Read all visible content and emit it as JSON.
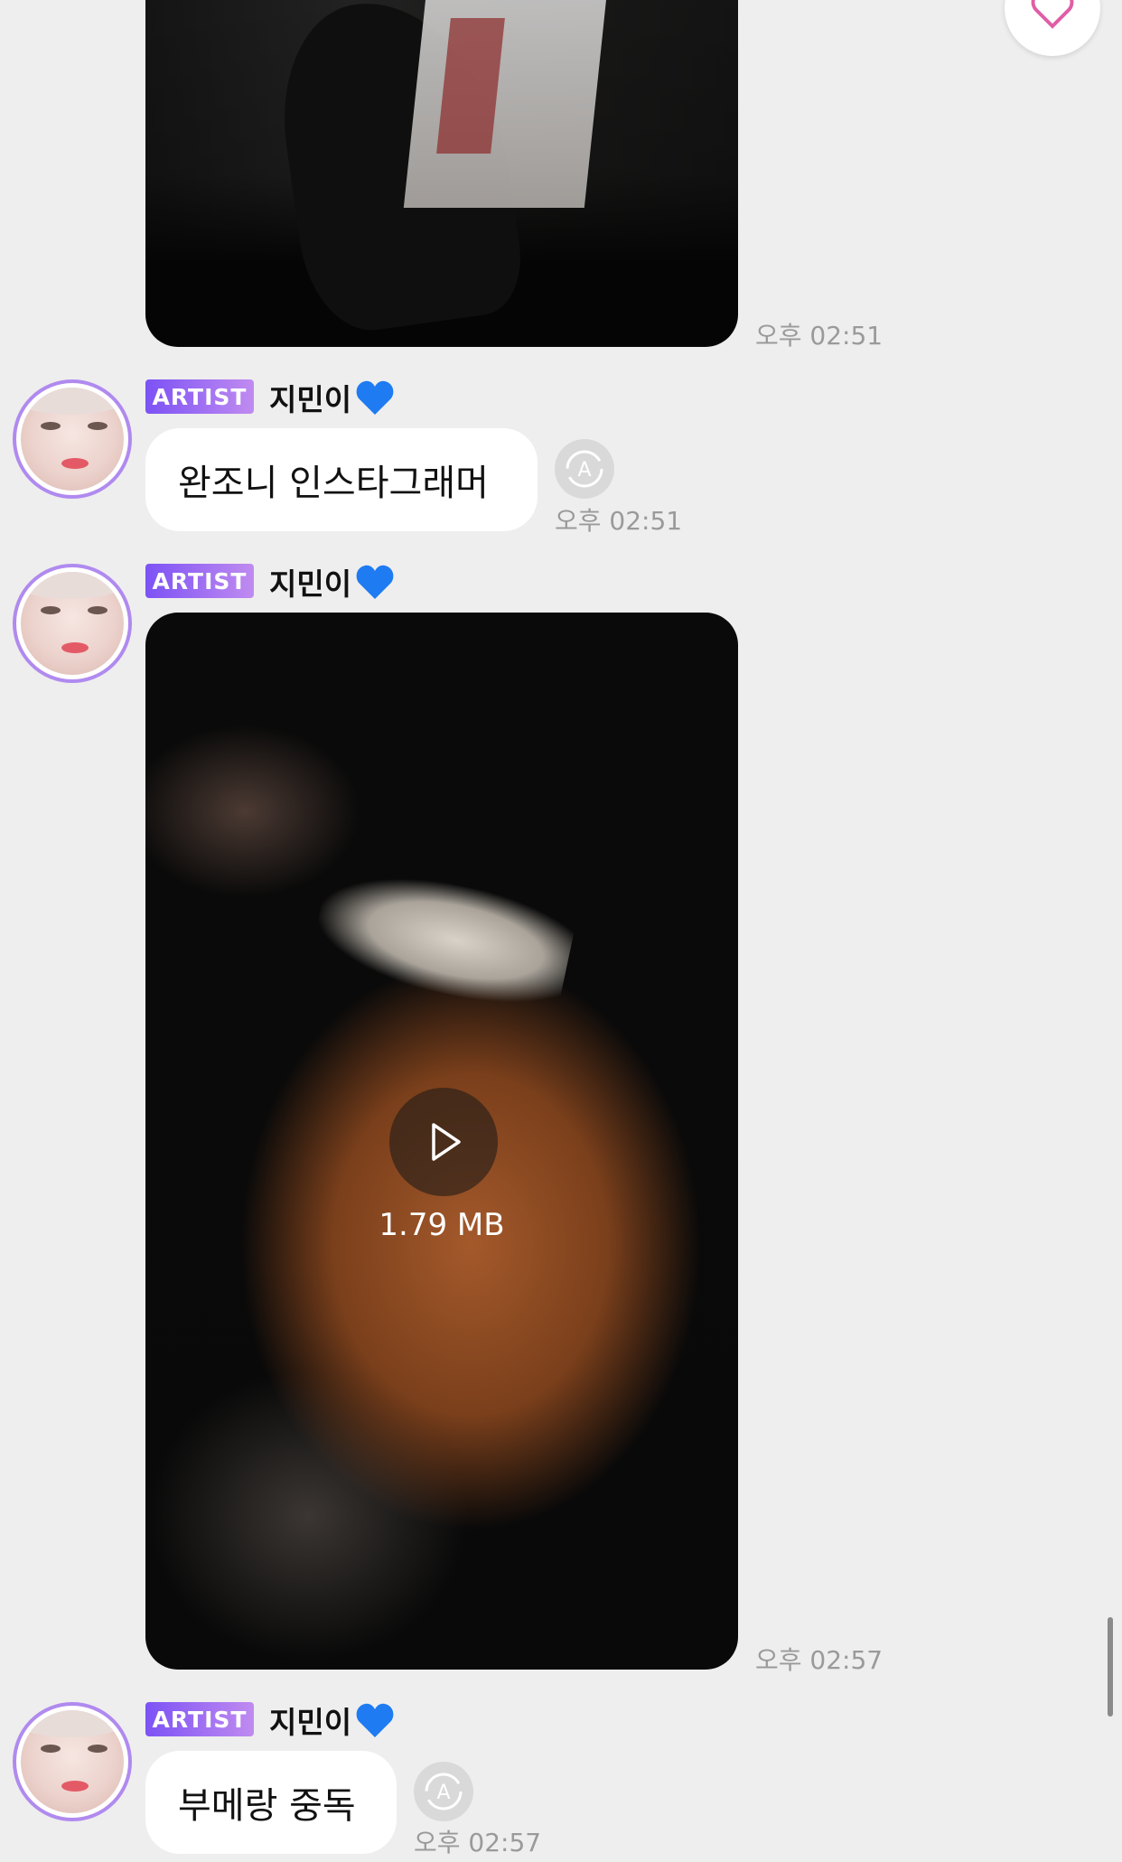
{
  "messages": [
    {
      "type": "video",
      "time": "오후 02:51"
    },
    {
      "type": "text",
      "badge": "ARTIST",
      "sender": "지민이",
      "text": "완조니 인스타그래머",
      "time": "오후 02:51"
    },
    {
      "type": "video",
      "badge": "ARTIST",
      "sender": "지민이",
      "file_size": "1.79 MB",
      "time": "오후 02:57"
    },
    {
      "type": "text",
      "badge": "ARTIST",
      "sender": "지민이",
      "text": "부메랑 중독",
      "time": "오후 02:57"
    }
  ],
  "colors": {
    "background": "#eeeeee",
    "badge_start": "#7c52f5",
    "badge_end": "#c08bf0",
    "avatar_ring": "#b08aef",
    "heart_blue": "#1e7bf2",
    "fab_icon": "#e05ea6",
    "timestamp": "#9a9a9a"
  },
  "icons": {
    "name_emoji": "blue-heart-icon",
    "translate": "translate-icon",
    "play": "play-icon",
    "fab": "heart-icon"
  }
}
